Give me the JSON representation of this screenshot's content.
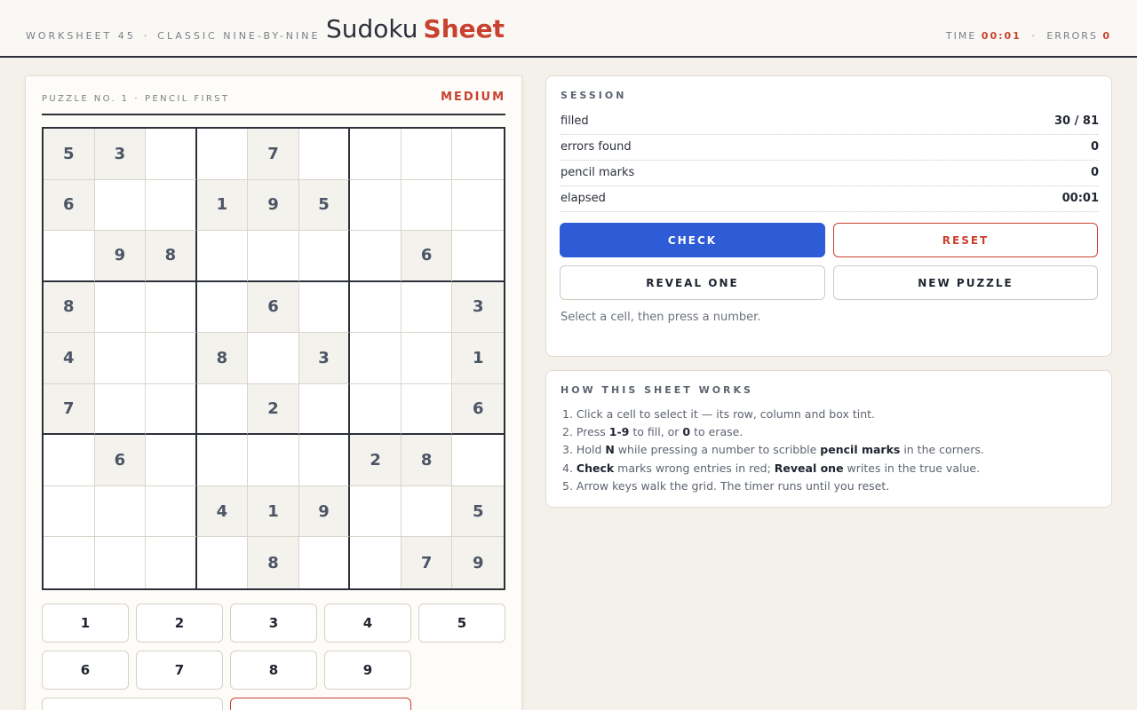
{
  "header": {
    "kicker": [
      "WORKSHEET 45",
      "CLASSIC NINE-BY-NINE"
    ],
    "title_plain": "Sudoku",
    "title_accent": "Sheet",
    "time_label": "TIME",
    "time_value": "00:01",
    "errors_label": "ERRORS",
    "errors_value": "0",
    "separator": "·"
  },
  "board": {
    "subtitle": [
      "PUZZLE NO. 1",
      "PENCIL FIRST"
    ],
    "difficulty": "MEDIUM",
    "grid": [
      [
        5,
        3,
        0,
        0,
        7,
        0,
        0,
        0,
        0
      ],
      [
        6,
        0,
        0,
        1,
        9,
        5,
        0,
        0,
        0
      ],
      [
        0,
        9,
        8,
        0,
        0,
        0,
        0,
        6,
        0
      ],
      [
        8,
        0,
        0,
        0,
        6,
        0,
        0,
        0,
        3
      ],
      [
        4,
        0,
        0,
        8,
        0,
        3,
        0,
        0,
        1
      ],
      [
        7,
        0,
        0,
        0,
        2,
        0,
        0,
        0,
        6
      ],
      [
        0,
        6,
        0,
        0,
        0,
        0,
        2,
        8,
        0
      ],
      [
        0,
        0,
        0,
        4,
        1,
        9,
        0,
        0,
        5
      ],
      [
        0,
        0,
        0,
        0,
        8,
        0,
        0,
        7,
        9
      ]
    ]
  },
  "keypad": {
    "numbers": [
      "1",
      "2",
      "3",
      "4",
      "5",
      "6",
      "7",
      "8",
      "9"
    ]
  },
  "session": {
    "title": "SESSION",
    "rows": [
      {
        "label": "filled",
        "value": "30 / 81"
      },
      {
        "label": "errors found",
        "value": "0"
      },
      {
        "label": "pencil marks",
        "value": "0"
      },
      {
        "label": "elapsed",
        "value": "00:01"
      }
    ],
    "check_label": "CHECK",
    "reset_label": "RESET",
    "reveal_label": "REVEAL ONE",
    "new_label": "NEW PUZZLE",
    "hint": "Select a cell, then press a number."
  },
  "help": {
    "title": "HOW THIS SHEET WORKS",
    "items": [
      {
        "n": "1.",
        "parts": [
          [
            "t",
            "Click a cell to select it — its row, column and box tint."
          ]
        ]
      },
      {
        "n": "2.",
        "parts": [
          [
            "t",
            "Press "
          ],
          [
            "b",
            "1-9"
          ],
          [
            "t",
            " to fill, or "
          ],
          [
            "b",
            "0"
          ],
          [
            "t",
            " to erase."
          ]
        ]
      },
      {
        "n": "3.",
        "parts": [
          [
            "t",
            "Hold "
          ],
          [
            "b",
            "N"
          ],
          [
            "t",
            " while pressing a number to scribble "
          ],
          [
            "b",
            "pencil marks"
          ],
          [
            "t",
            " in the corners."
          ]
        ]
      },
      {
        "n": "4.",
        "parts": [
          [
            "b",
            "Check"
          ],
          [
            "t",
            " marks wrong entries in red; "
          ],
          [
            "b",
            "Reveal one"
          ],
          [
            "t",
            " writes in the true value."
          ]
        ]
      },
      {
        "n": "5.",
        "parts": [
          [
            "t",
            "Arrow keys walk the grid. The timer runs until you reset."
          ]
        ]
      }
    ]
  },
  "colors": {
    "accent": "#c9412f",
    "primary": "#2e5bd6",
    "ink": "#2b303a",
    "given_bg": "#f4f2ec"
  }
}
